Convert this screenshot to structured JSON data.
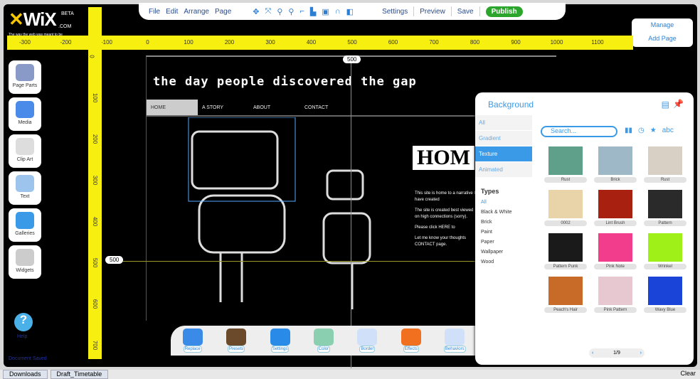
{
  "logo": {
    "text": "WiX",
    "beta": "BETA",
    "com": ".COM",
    "tagline": "The way the web was meant to be"
  },
  "menu": {
    "file": "File",
    "edit": "Edit",
    "arrange": "Arrange",
    "page": "Page",
    "settings": "Settings",
    "preview": "Preview",
    "save": "Save",
    "publish": "Publish"
  },
  "toolbar_icons": [
    "move-icon",
    "fit-icon",
    "zoom-in-icon",
    "zoom-out-icon",
    "align-icon",
    "distribute-icon",
    "frame-icon",
    "magnet-icon",
    "layers-icon"
  ],
  "page_panel": {
    "manage": "Manage",
    "add_page": "Add Page"
  },
  "hruler": [
    "-300",
    "-200",
    "-100",
    "0",
    "100",
    "200",
    "300",
    "400",
    "500",
    "600",
    "700",
    "800",
    "900",
    "1000",
    "1100"
  ],
  "vruler": [
    "0",
    "100",
    "200",
    "300",
    "400",
    "500",
    "600",
    "700"
  ],
  "sidebar": [
    {
      "label": "Page Parts"
    },
    {
      "label": "Media"
    },
    {
      "label": "Clip Art"
    },
    {
      "label": "Text"
    },
    {
      "label": "Galleries"
    },
    {
      "label": "Widgets"
    }
  ],
  "help": "Help",
  "status": "Document Saved",
  "site": {
    "title": "the day people discovered the gap",
    "nav": [
      "HOME",
      "A STORY",
      "ABOUT",
      "CONTACT"
    ],
    "home_heading": "HOM",
    "bullets": [
      "This site is home to a narrative I have created",
      "The site is created best viewed on high connections (sorry).",
      "Please click HERE to",
      "Let me know your thoughts CONTACT page."
    ]
  },
  "markers": {
    "top": "500",
    "left": "500"
  },
  "bottom_tools": [
    "Replace",
    "Presets",
    "Settings",
    "Color",
    "Border",
    "Effects",
    "Behaviors"
  ],
  "background": {
    "title": "Background",
    "categories": [
      "All",
      "Gradient",
      "Texture",
      "Animated"
    ],
    "selected_category": "Texture",
    "types_heading": "Types",
    "types": [
      "All",
      "Black & White",
      "Brick",
      "Paint",
      "Paper",
      "Wallpaper",
      "Wood"
    ],
    "search_placeholder": "Search...",
    "sort_abc": "abc",
    "items": [
      {
        "name": "Rust",
        "color": "#5fa08a"
      },
      {
        "name": "Brick",
        "color": "#9fb8c8"
      },
      {
        "name": "Rust",
        "color": "#d8d0c4"
      },
      {
        "name": "0002",
        "color": "#e8d4a8"
      },
      {
        "name": "Lint Brush",
        "color": "#a82010"
      },
      {
        "name": "Pattern",
        "color": "#2a2a2a"
      },
      {
        "name": "Pattern Punk",
        "color": "#1a1a1a"
      },
      {
        "name": "Pink Note",
        "color": "#f23c8c"
      },
      {
        "name": "Wrinkel",
        "color": "#9ef018"
      },
      {
        "name": "Peach's Hair",
        "color": "#c86a28"
      },
      {
        "name": "Pink Pattern",
        "color": "#e8c8d0"
      },
      {
        "name": "Wavy Blue",
        "color": "#1a44d8"
      }
    ],
    "page": "1/9"
  },
  "taskbar": [
    "Downloads",
    "Draft_Timetable"
  ],
  "clear": "Clear"
}
